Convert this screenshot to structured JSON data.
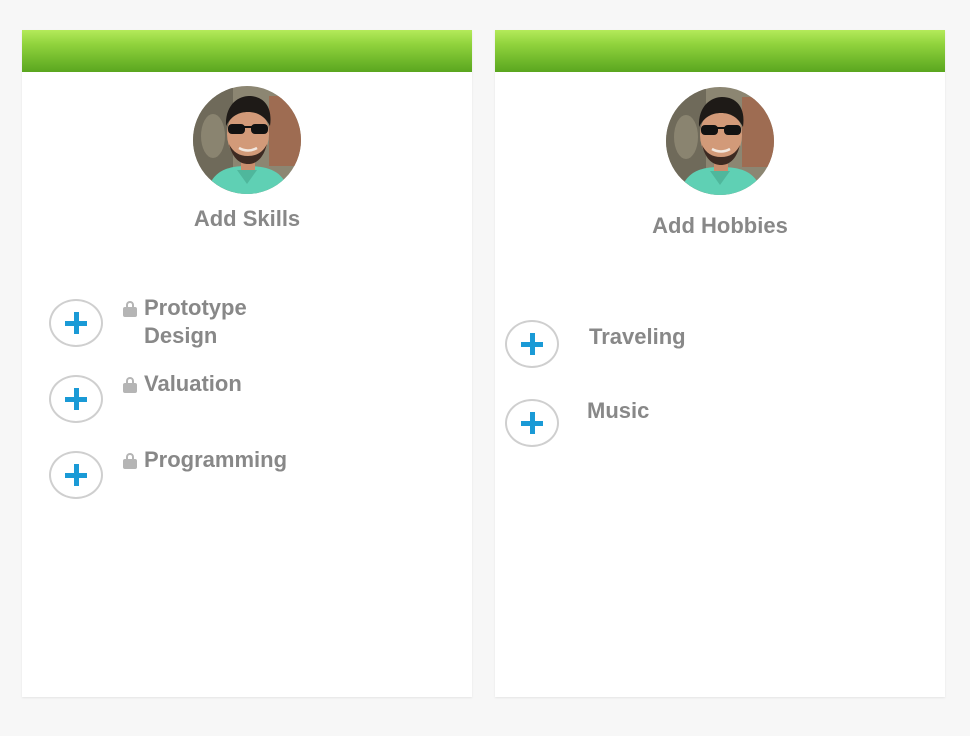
{
  "skills_card": {
    "title": "Add Skills",
    "items": [
      {
        "label": "Prototype Design",
        "locked": true
      },
      {
        "label": "Valuation",
        "locked": true
      },
      {
        "label": "Programming",
        "locked": true
      }
    ]
  },
  "hobbies_card": {
    "title": "Add Hobbies",
    "items": [
      {
        "label": "Traveling"
      },
      {
        "label": "Music"
      }
    ]
  },
  "colors": {
    "header_light": "#b4ea5a",
    "header_dark": "#5aa61f",
    "plus": "#1a9ad6",
    "text": "#888888",
    "lock": "#b5b5b5",
    "button_border": "#cfcfcf"
  },
  "icons": {
    "add": "plus-icon",
    "lock": "lock-icon",
    "avatar": "profile-photo"
  }
}
